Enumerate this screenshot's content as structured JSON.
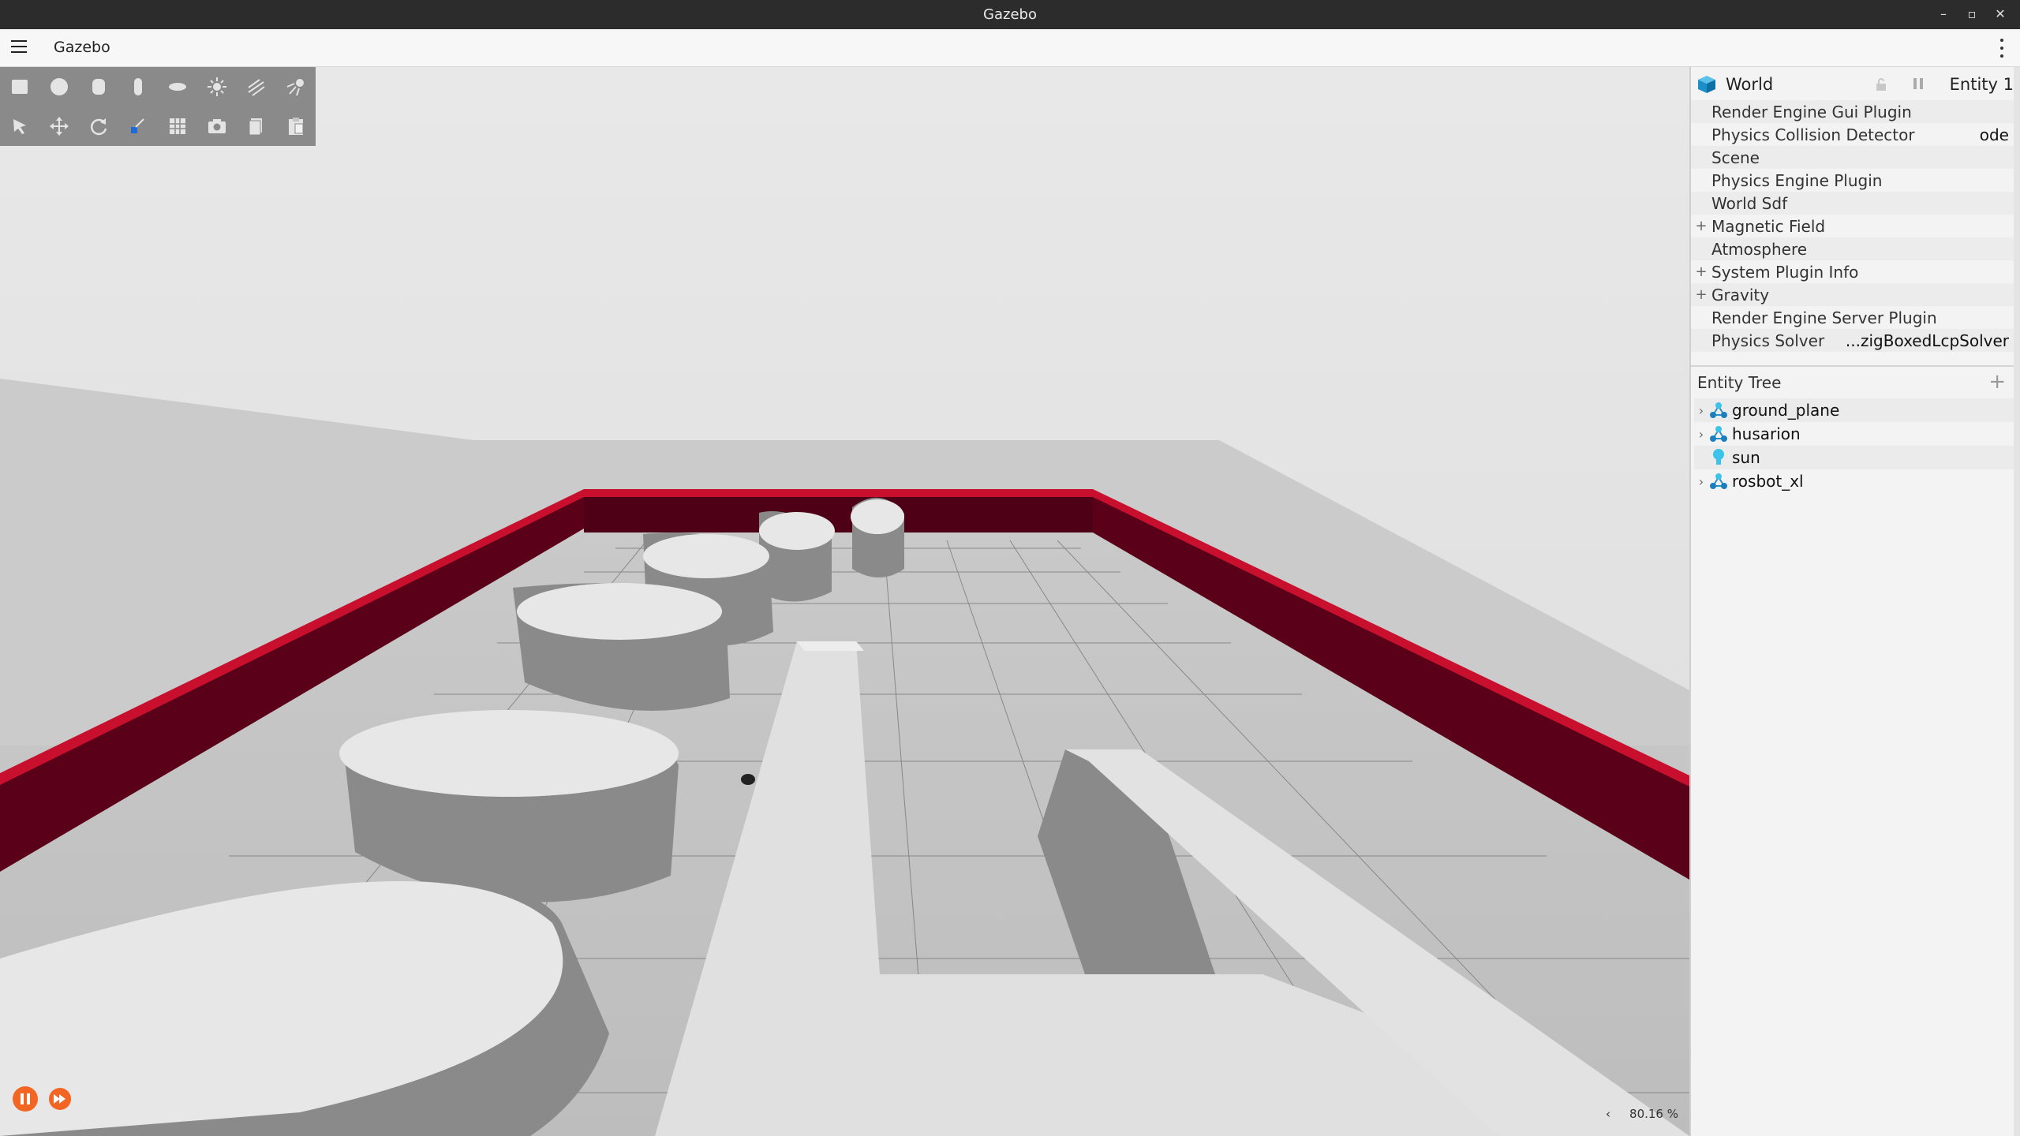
{
  "window": {
    "title": "Gazebo"
  },
  "menubar": {
    "app_name": "Gazebo"
  },
  "component_inspector": {
    "entity_name": "World",
    "entity_id_label": "Entity 1",
    "rows": [
      {
        "expand": "",
        "label": "Render Engine Gui Plugin",
        "value": ""
      },
      {
        "expand": "",
        "label": "Physics Collision Detector",
        "value": "ode"
      },
      {
        "expand": "",
        "label": "Scene",
        "value": ""
      },
      {
        "expand": "",
        "label": "Physics Engine Plugin",
        "value": ""
      },
      {
        "expand": "",
        "label": "World Sdf",
        "value": ""
      },
      {
        "expand": "+",
        "label": "Magnetic Field",
        "value": ""
      },
      {
        "expand": "",
        "label": "Atmosphere",
        "value": ""
      },
      {
        "expand": "+",
        "label": "System Plugin Info",
        "value": ""
      },
      {
        "expand": "+",
        "label": "Gravity",
        "value": ""
      },
      {
        "expand": "",
        "label": "Render Engine Server Plugin",
        "value": ""
      },
      {
        "expand": "",
        "label": "Physics Solver",
        "value": "...zigBoxedLcpSolver"
      }
    ]
  },
  "entity_tree": {
    "title": "Entity Tree",
    "items": [
      {
        "name": "ground_plane",
        "icon": "model-icon",
        "expandable": true
      },
      {
        "name": "husarion",
        "icon": "model-icon",
        "expandable": true
      },
      {
        "name": "sun",
        "icon": "light-bulb-icon",
        "expandable": false
      },
      {
        "name": "rosbot_xl",
        "icon": "model-icon",
        "expandable": true
      }
    ]
  },
  "status": {
    "rtf": "80.16 %",
    "collapse_arrow": "‹"
  },
  "colors": {
    "wall": "#5a0018",
    "wall_top": "#c8102e",
    "play_button": "#f26522",
    "ground": "#cfcfcf",
    "obstacle": "#8a8a8a",
    "obstacle_top": "#e6e6e6"
  }
}
